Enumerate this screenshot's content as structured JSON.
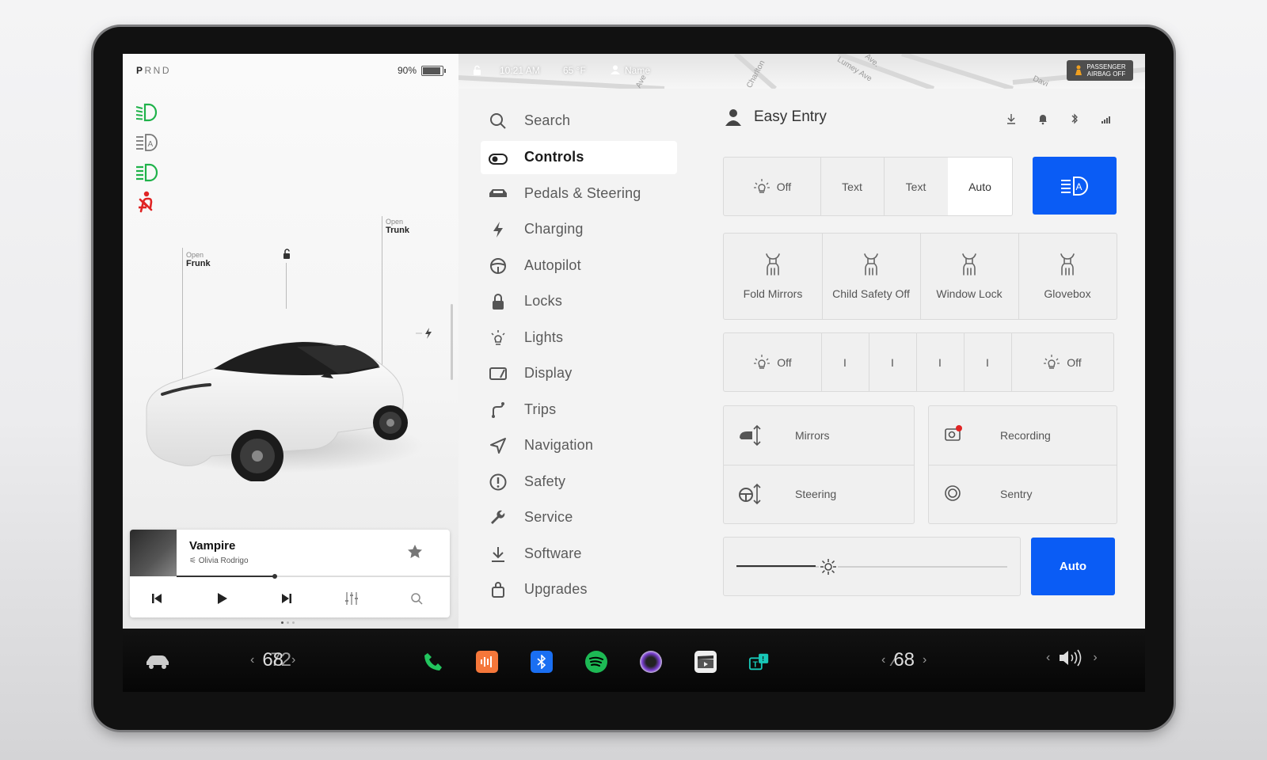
{
  "status": {
    "gear": {
      "selected": "P",
      "others": "RND"
    },
    "battery_percent": "90%",
    "battery_level": 0.9,
    "time": "10:21 AM",
    "temperature": "65 °F",
    "profile_name": "Name",
    "airbag_line1": "PASSENGER",
    "airbag_line2": "AIRBAG OFF",
    "streets": [
      "Charlton",
      "Ave",
      "Ave.",
      "Lumey Ave",
      "Davi"
    ]
  },
  "car": {
    "frunk": {
      "state": "Open",
      "label": "Frunk"
    },
    "trunk": {
      "state": "Open",
      "label": "Trunk"
    }
  },
  "media": {
    "title": "Vampire",
    "artist": "Olivia Rodrigo",
    "progress": 0.36
  },
  "menu": {
    "items": [
      {
        "label": "Search",
        "icon": "search-icon"
      },
      {
        "label": "Controls",
        "icon": "toggle-icon",
        "selected": true
      },
      {
        "label": "Pedals & Steering",
        "icon": "car-icon"
      },
      {
        "label": "Charging",
        "icon": "bolt-icon"
      },
      {
        "label": "Autopilot",
        "icon": "steering-wheel-icon"
      },
      {
        "label": "Locks",
        "icon": "lock-icon"
      },
      {
        "label": "Lights",
        "icon": "bulb-icon"
      },
      {
        "label": "Display",
        "icon": "display-icon"
      },
      {
        "label": "Trips",
        "icon": "trips-icon"
      },
      {
        "label": "Navigation",
        "icon": "navigation-icon"
      },
      {
        "label": "Safety",
        "icon": "alert-icon"
      },
      {
        "label": "Service",
        "icon": "wrench-icon"
      },
      {
        "label": "Software",
        "icon": "download-icon"
      },
      {
        "label": "Upgrades",
        "icon": "bag-icon"
      }
    ]
  },
  "controls": {
    "header": "Easy Entry",
    "headlights": {
      "options": [
        "Off",
        "Text",
        "Text",
        "Auto"
      ],
      "selected": "Auto"
    },
    "quick": [
      "Fold Mirrors",
      "Child Safety Off",
      "Window Lock",
      "Glovebox"
    ],
    "wipers": [
      "Off",
      "I",
      "I",
      "I",
      "I",
      "Off"
    ],
    "adjust": [
      "Mirrors",
      "Steering"
    ],
    "camera": [
      "Recording",
      "Sentry"
    ],
    "brightness_level": 0.34,
    "brightness_auto": "Auto"
  },
  "dock": {
    "temp_driver": "68",
    "temp_driver_alt": "72",
    "temp_passenger": "68",
    "apps": [
      "phone",
      "voice",
      "bluetooth",
      "spotify",
      "camera",
      "theater",
      "toybox"
    ],
    "colors": {
      "phone": "#22c55e",
      "voice": "#f5773a",
      "bluetooth": "#1a6ff2",
      "spotify": "#1db954",
      "accent": "#0a5cf5"
    }
  }
}
